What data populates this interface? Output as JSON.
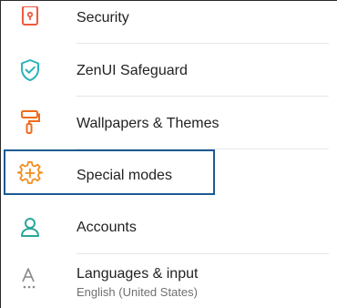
{
  "settings": {
    "items": [
      {
        "label": "Security",
        "icon": "lock-icon",
        "color": "#f05a3e"
      },
      {
        "label": "ZenUI Safeguard",
        "icon": "shield-check-icon",
        "color": "#2bb3b8"
      },
      {
        "label": "Wallpapers & Themes",
        "icon": "paint-roller-icon",
        "color": "#f26b1d"
      },
      {
        "label": "Special modes",
        "icon": "gear-plus-icon",
        "color": "#f38b1c",
        "highlighted": true
      },
      {
        "label": "Accounts",
        "icon": "person-icon",
        "color": "#2aa79a"
      },
      {
        "label": "Languages & input",
        "sublabel": "English (United States)",
        "icon": "language-icon",
        "color": "#8a8a8a"
      }
    ]
  },
  "colors": {
    "highlight_border": "#1c5a94",
    "divider": "#e6e6e6"
  }
}
